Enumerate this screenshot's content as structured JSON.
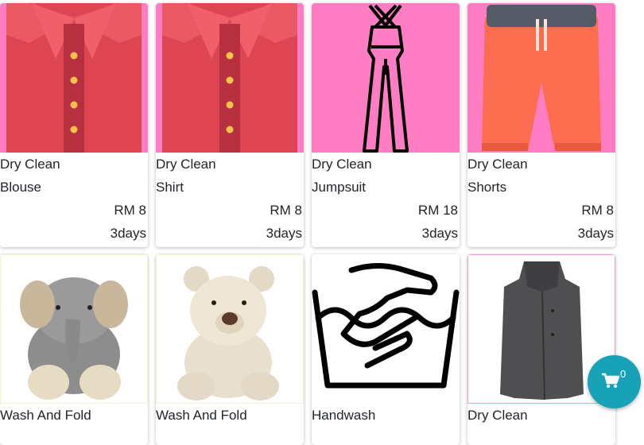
{
  "products": [
    {
      "category": "Dry Clean",
      "name": "Blouse",
      "price": "RM 8",
      "duration": "3days",
      "icon": "shirt-image"
    },
    {
      "category": "Dry Clean",
      "name": "Shirt",
      "price": "RM 8",
      "duration": "3days",
      "icon": "shirt-image"
    },
    {
      "category": "Dry Clean",
      "name": "Jumpsuit",
      "price": "RM 18",
      "duration": "3days",
      "icon": "jumpsuit-image"
    },
    {
      "category": "Dry Clean",
      "name": "Shorts",
      "price": "RM 8",
      "duration": "3days",
      "icon": "shorts-image"
    },
    {
      "category": "Wash And Fold",
      "icon": "elephant-plush-image"
    },
    {
      "category": "Wash And Fold",
      "icon": "teddy-bear-image"
    },
    {
      "category": "Handwash",
      "icon": "handwash-symbol-image"
    },
    {
      "category": "Dry Clean",
      "icon": "coat-image"
    }
  ],
  "cart": {
    "count": "0",
    "icon": "shopping-cart-icon",
    "color": "#17a2b8"
  },
  "colors": {
    "image_background": "#fe7dc3"
  }
}
